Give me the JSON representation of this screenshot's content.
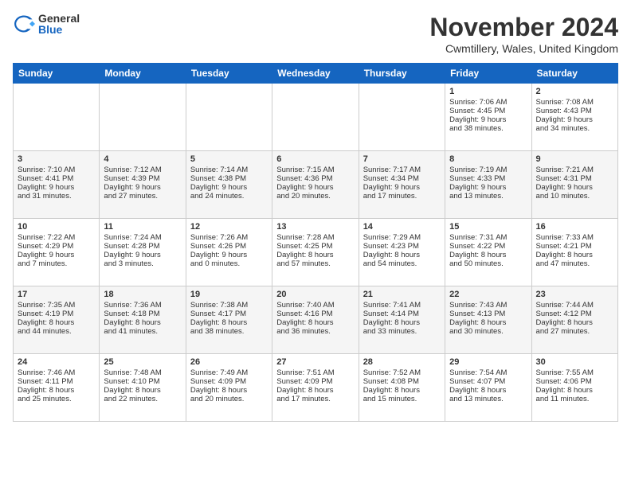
{
  "header": {
    "logo_general": "General",
    "logo_blue": "Blue",
    "month_title": "November 2024",
    "location": "Cwmtillery, Wales, United Kingdom"
  },
  "days_of_week": [
    "Sunday",
    "Monday",
    "Tuesday",
    "Wednesday",
    "Thursday",
    "Friday",
    "Saturday"
  ],
  "weeks": [
    [
      {
        "day": "",
        "info": ""
      },
      {
        "day": "",
        "info": ""
      },
      {
        "day": "",
        "info": ""
      },
      {
        "day": "",
        "info": ""
      },
      {
        "day": "",
        "info": ""
      },
      {
        "day": "1",
        "info": "Sunrise: 7:06 AM\nSunset: 4:45 PM\nDaylight: 9 hours\nand 38 minutes."
      },
      {
        "day": "2",
        "info": "Sunrise: 7:08 AM\nSunset: 4:43 PM\nDaylight: 9 hours\nand 34 minutes."
      }
    ],
    [
      {
        "day": "3",
        "info": "Sunrise: 7:10 AM\nSunset: 4:41 PM\nDaylight: 9 hours\nand 31 minutes."
      },
      {
        "day": "4",
        "info": "Sunrise: 7:12 AM\nSunset: 4:39 PM\nDaylight: 9 hours\nand 27 minutes."
      },
      {
        "day": "5",
        "info": "Sunrise: 7:14 AM\nSunset: 4:38 PM\nDaylight: 9 hours\nand 24 minutes."
      },
      {
        "day": "6",
        "info": "Sunrise: 7:15 AM\nSunset: 4:36 PM\nDaylight: 9 hours\nand 20 minutes."
      },
      {
        "day": "7",
        "info": "Sunrise: 7:17 AM\nSunset: 4:34 PM\nDaylight: 9 hours\nand 17 minutes."
      },
      {
        "day": "8",
        "info": "Sunrise: 7:19 AM\nSunset: 4:33 PM\nDaylight: 9 hours\nand 13 minutes."
      },
      {
        "day": "9",
        "info": "Sunrise: 7:21 AM\nSunset: 4:31 PM\nDaylight: 9 hours\nand 10 minutes."
      }
    ],
    [
      {
        "day": "10",
        "info": "Sunrise: 7:22 AM\nSunset: 4:29 PM\nDaylight: 9 hours\nand 7 minutes."
      },
      {
        "day": "11",
        "info": "Sunrise: 7:24 AM\nSunset: 4:28 PM\nDaylight: 9 hours\nand 3 minutes."
      },
      {
        "day": "12",
        "info": "Sunrise: 7:26 AM\nSunset: 4:26 PM\nDaylight: 9 hours\nand 0 minutes."
      },
      {
        "day": "13",
        "info": "Sunrise: 7:28 AM\nSunset: 4:25 PM\nDaylight: 8 hours\nand 57 minutes."
      },
      {
        "day": "14",
        "info": "Sunrise: 7:29 AM\nSunset: 4:23 PM\nDaylight: 8 hours\nand 54 minutes."
      },
      {
        "day": "15",
        "info": "Sunrise: 7:31 AM\nSunset: 4:22 PM\nDaylight: 8 hours\nand 50 minutes."
      },
      {
        "day": "16",
        "info": "Sunrise: 7:33 AM\nSunset: 4:21 PM\nDaylight: 8 hours\nand 47 minutes."
      }
    ],
    [
      {
        "day": "17",
        "info": "Sunrise: 7:35 AM\nSunset: 4:19 PM\nDaylight: 8 hours\nand 44 minutes."
      },
      {
        "day": "18",
        "info": "Sunrise: 7:36 AM\nSunset: 4:18 PM\nDaylight: 8 hours\nand 41 minutes."
      },
      {
        "day": "19",
        "info": "Sunrise: 7:38 AM\nSunset: 4:17 PM\nDaylight: 8 hours\nand 38 minutes."
      },
      {
        "day": "20",
        "info": "Sunrise: 7:40 AM\nSunset: 4:16 PM\nDaylight: 8 hours\nand 36 minutes."
      },
      {
        "day": "21",
        "info": "Sunrise: 7:41 AM\nSunset: 4:14 PM\nDaylight: 8 hours\nand 33 minutes."
      },
      {
        "day": "22",
        "info": "Sunrise: 7:43 AM\nSunset: 4:13 PM\nDaylight: 8 hours\nand 30 minutes."
      },
      {
        "day": "23",
        "info": "Sunrise: 7:44 AM\nSunset: 4:12 PM\nDaylight: 8 hours\nand 27 minutes."
      }
    ],
    [
      {
        "day": "24",
        "info": "Sunrise: 7:46 AM\nSunset: 4:11 PM\nDaylight: 8 hours\nand 25 minutes."
      },
      {
        "day": "25",
        "info": "Sunrise: 7:48 AM\nSunset: 4:10 PM\nDaylight: 8 hours\nand 22 minutes."
      },
      {
        "day": "26",
        "info": "Sunrise: 7:49 AM\nSunset: 4:09 PM\nDaylight: 8 hours\nand 20 minutes."
      },
      {
        "day": "27",
        "info": "Sunrise: 7:51 AM\nSunset: 4:09 PM\nDaylight: 8 hours\nand 17 minutes."
      },
      {
        "day": "28",
        "info": "Sunrise: 7:52 AM\nSunset: 4:08 PM\nDaylight: 8 hours\nand 15 minutes."
      },
      {
        "day": "29",
        "info": "Sunrise: 7:54 AM\nSunset: 4:07 PM\nDaylight: 8 hours\nand 13 minutes."
      },
      {
        "day": "30",
        "info": "Sunrise: 7:55 AM\nSunset: 4:06 PM\nDaylight: 8 hours\nand 11 minutes."
      }
    ]
  ]
}
